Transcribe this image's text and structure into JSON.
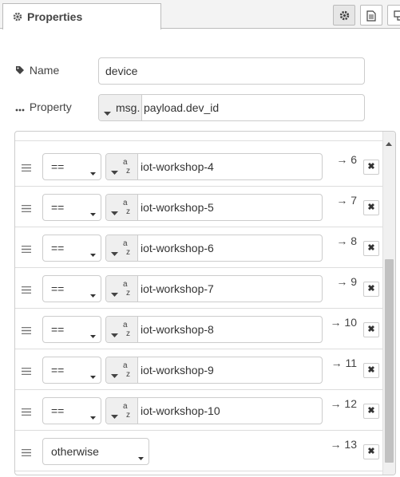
{
  "tabs": {
    "properties_label": "Properties",
    "icons": [
      "gear-icon",
      "file-text-icon",
      "node-info-icon"
    ]
  },
  "form": {
    "name_label": "Name",
    "name_value": "device",
    "property_label": "Property",
    "property_type": "msg.",
    "property_value": "payload.dev_id"
  },
  "rules": [
    {
      "operator": "==",
      "type": "string",
      "value": "iot-workshop-4",
      "output": "→ 6"
    },
    {
      "operator": "==",
      "type": "string",
      "value": "iot-workshop-5",
      "output": "→ 7"
    },
    {
      "operator": "==",
      "type": "string",
      "value": "iot-workshop-6",
      "output": "→ 8"
    },
    {
      "operator": "==",
      "type": "string",
      "value": "iot-workshop-7",
      "output": "→ 9"
    },
    {
      "operator": "==",
      "type": "string",
      "value": "iot-workshop-8",
      "output": "→ 10"
    },
    {
      "operator": "==",
      "type": "string",
      "value": "iot-workshop-9",
      "output": "→ 11"
    },
    {
      "operator": "==",
      "type": "string",
      "value": "iot-workshop-10",
      "output": "→ 12"
    },
    {
      "operator": "otherwise",
      "output": "→ 13"
    }
  ],
  "delete_glyph": "✖",
  "type_badge": {
    "a": "a",
    "z": "z"
  },
  "colors": {
    "tab_bg": "#f3f3f3",
    "border": "#cccccc",
    "scroll_thumb": "#c1c1c1"
  }
}
